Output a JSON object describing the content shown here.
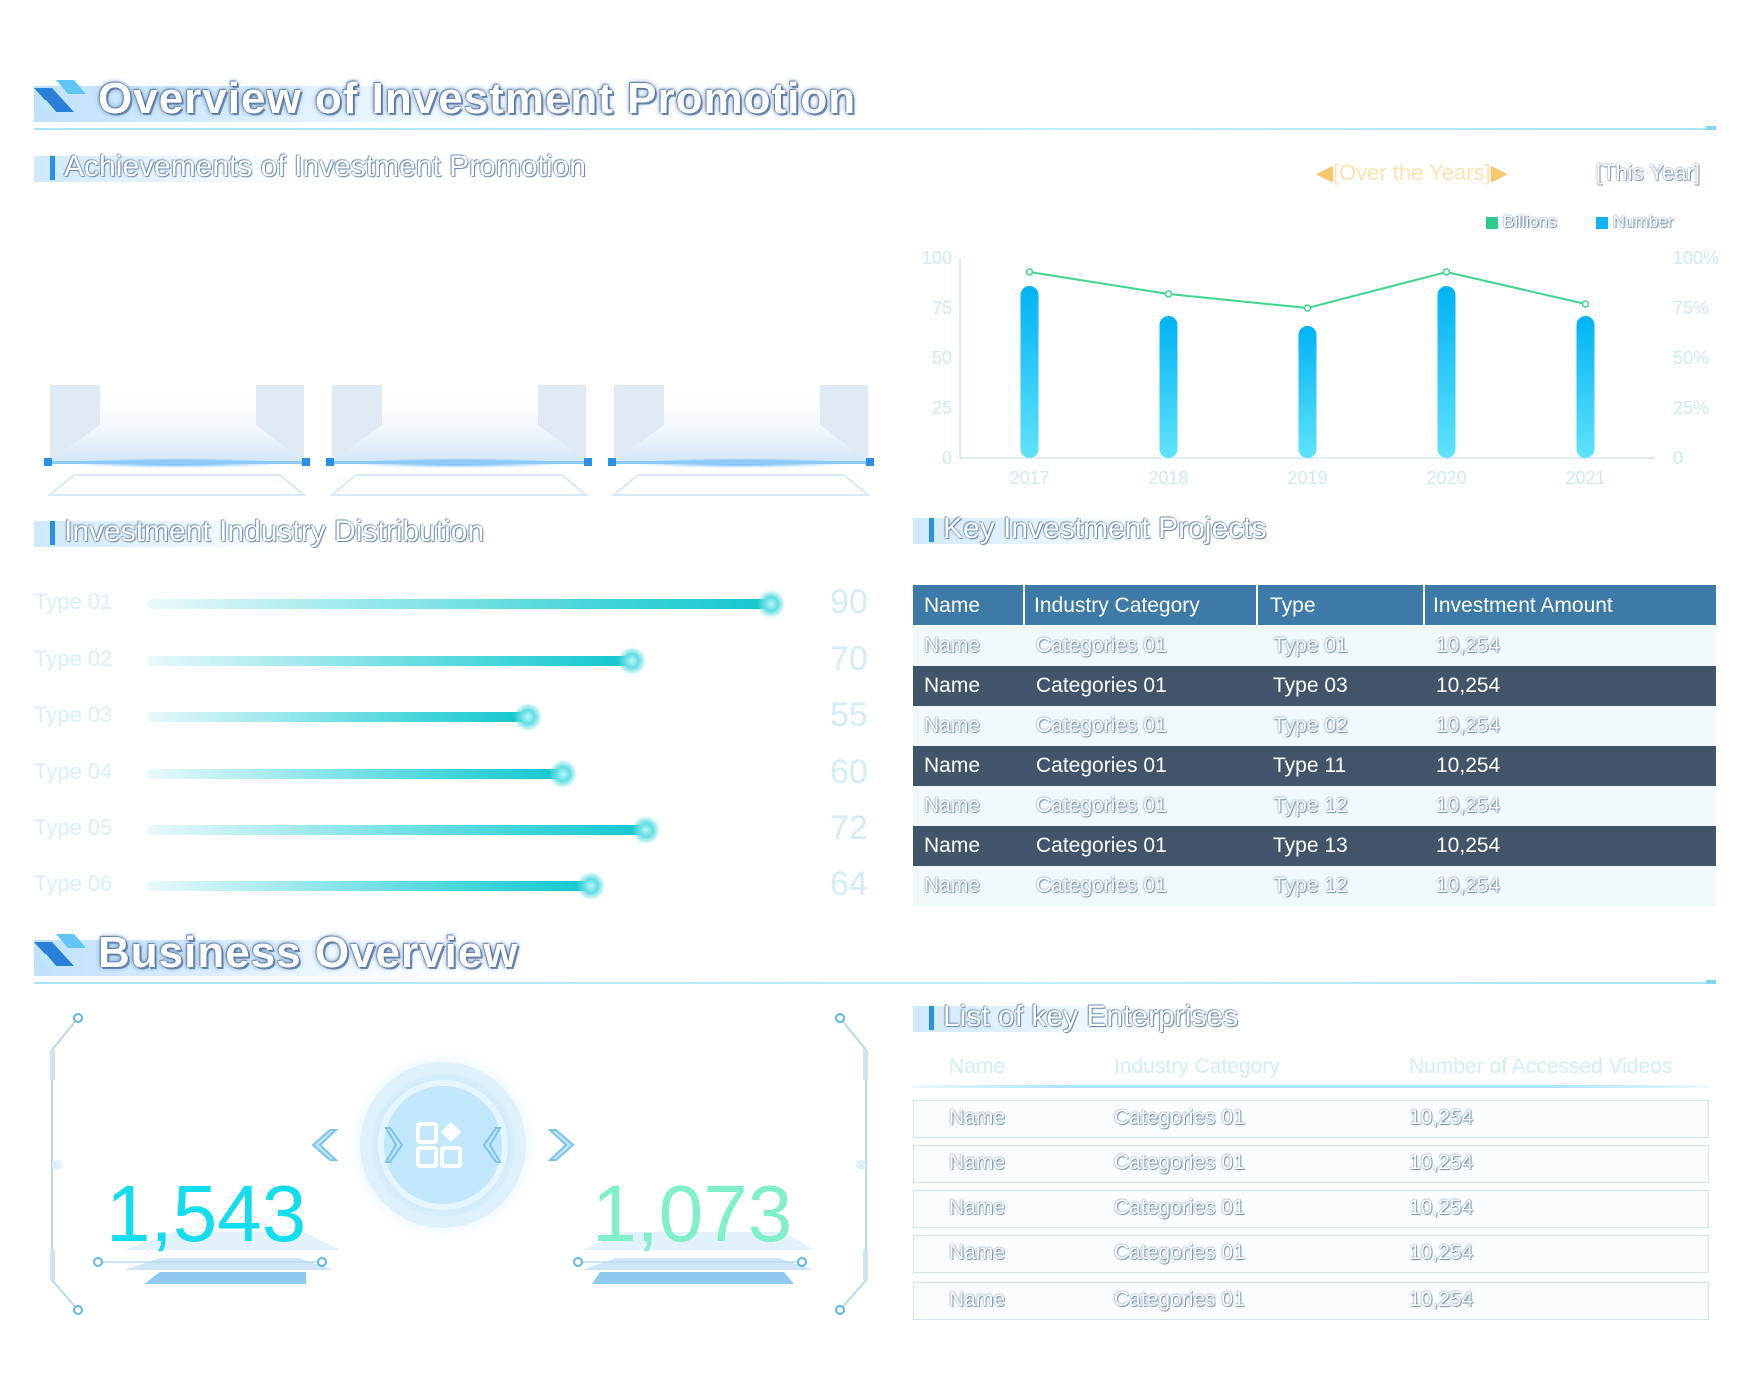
{
  "sections": {
    "overview_title": "Overview of Investment Promotion",
    "business_title": "Business Overview"
  },
  "subsections": {
    "achievements": "Achievements of Investment Promotion",
    "distribution": "Investment Industry Distribution",
    "key_projects": "Key Investment Projects",
    "key_enterprises": "List of key Enterprises"
  },
  "tabs": {
    "over_years": "[Over the Years]",
    "this_year": "[This Year]"
  },
  "legend": {
    "billions": "Billions",
    "number": "Number"
  },
  "colors": {
    "accent_blue": "#00b7f5",
    "line_green": "#3dd68c",
    "teal": "#14c6cf",
    "table_header": "#3d7aa8",
    "table_dark_row": "#41546a"
  },
  "chart_data": {
    "type": "bar",
    "categories": [
      "2017",
      "2018",
      "2019",
      "2020",
      "2021"
    ],
    "series": [
      {
        "name": "Number",
        "type": "bar",
        "values": [
          86,
          71,
          66,
          86,
          71
        ]
      },
      {
        "name": "Billions",
        "type": "line",
        "values": [
          93,
          82,
          75,
          93,
          77
        ]
      }
    ],
    "y_left_ticks": [
      "0",
      "25",
      "50",
      "75",
      "100"
    ],
    "y_right_ticks": [
      "0",
      "25%",
      "50%",
      "75%",
      "100%"
    ],
    "ylim": [
      0,
      100
    ],
    "legend_position": "top-right",
    "grid": false
  },
  "distribution": {
    "rows": [
      {
        "label": "Type 01",
        "value": "90",
        "fill": 0.9
      },
      {
        "label": "Type 02",
        "value": "70",
        "fill": 0.7
      },
      {
        "label": "Type 03",
        "value": "55",
        "fill": 0.55
      },
      {
        "label": "Type 04",
        "value": "60",
        "fill": 0.6
      },
      {
        "label": "Type 05",
        "value": "72",
        "fill": 0.72
      },
      {
        "label": "Type 06",
        "value": "64",
        "fill": 0.64
      }
    ]
  },
  "key_projects": {
    "headers": [
      "Name",
      "Industry Category",
      "Type",
      "Investment Amount"
    ],
    "rows": [
      [
        "Name",
        "Categories 01",
        "Type 01",
        "10,254"
      ],
      [
        "Name",
        "Categories 01",
        "Type 03",
        "10,254"
      ],
      [
        "Name",
        "Categories 01",
        "Type 02",
        "10,254"
      ],
      [
        "Name",
        "Categories 01",
        "Type 11",
        "10,254"
      ],
      [
        "Name",
        "Categories 01",
        "Type 12",
        "10,254"
      ],
      [
        "Name",
        "Categories 01",
        "Type 13",
        "10,254"
      ],
      [
        "Name",
        "Categories 01",
        "Type 12",
        "10,254"
      ]
    ]
  },
  "enterprises": {
    "headers": [
      "Name",
      "Industry Category",
      "Number of Accessed Videos"
    ],
    "rows": [
      [
        "Name",
        "Categories 01",
        "10,254"
      ],
      [
        "Name",
        "Categories 01",
        "10,254"
      ],
      [
        "Name",
        "Categories 01",
        "10,254"
      ],
      [
        "Name",
        "Categories 01",
        "10,254"
      ],
      [
        "Name",
        "Categories 01",
        "10,254"
      ]
    ]
  },
  "business": {
    "left_value": "1,543",
    "right_value": "1,073",
    "center_icon": "grid-apps-icon"
  }
}
